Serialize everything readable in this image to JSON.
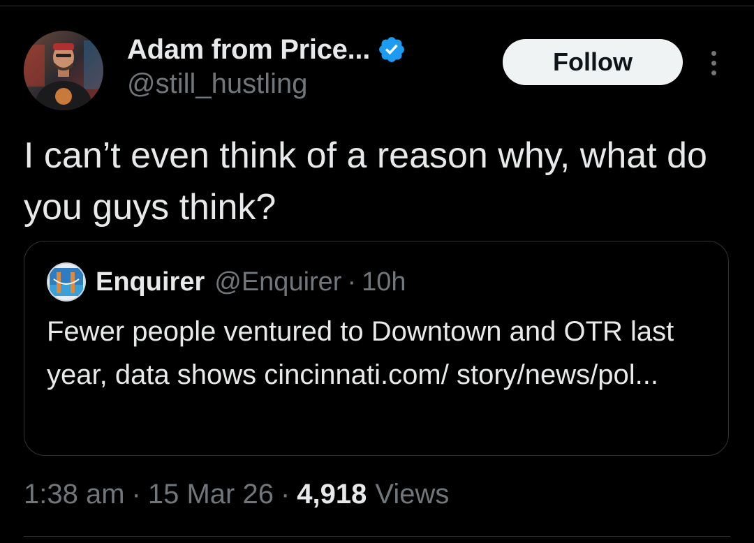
{
  "author": {
    "display_name": "Adam from Price...",
    "handle": "@still_hustling",
    "verified": true,
    "avatar_icon": "user-avatar-photo"
  },
  "actions": {
    "follow_label": "Follow",
    "more_icon": "more-vertical-icon"
  },
  "tweet": {
    "text": "I can’t even think of a reason why, what do you guys think?"
  },
  "quoted_tweet": {
    "display_name": "Enquirer",
    "handle": "@Enquirer",
    "separator": "·",
    "time": "10h",
    "text": "Fewer people ventured to Downtown and OTR last year, data shows cincinnati.com/ story/news/pol...",
    "avatar_icon": "enquirer-logo-avatar"
  },
  "meta": {
    "time": "1:38 am",
    "separator": "·",
    "date": "15 Mar 26",
    "views_count": "4,918",
    "views_label": "Views"
  },
  "colors": {
    "background": "#000000",
    "primary_text": "#e7e9ea",
    "secondary_text": "#71767b",
    "border": "#2f3336",
    "verified_blue": "#1d9bf0",
    "follow_button_bg": "#eff3f4",
    "follow_button_text": "#0f1419"
  }
}
